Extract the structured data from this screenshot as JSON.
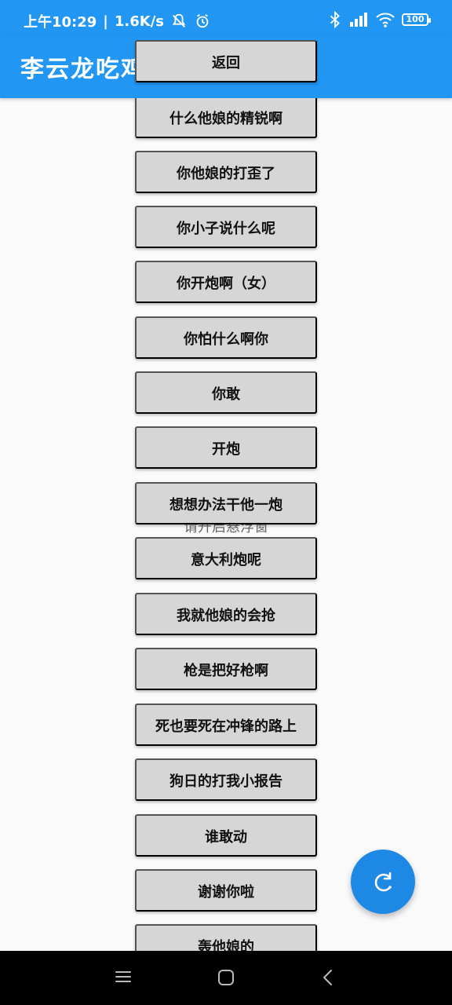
{
  "status_bar": {
    "time": "上午10:29",
    "speed": "1.6K/s",
    "battery": "100",
    "icons": [
      "bell-off-icon",
      "alarm-icon",
      "bluetooth-icon",
      "signal-icon",
      "wifi-icon",
      "battery-icon"
    ]
  },
  "app_bar": {
    "title": "李云龙吃鸡"
  },
  "hint": "请开启悬浮窗",
  "buttons": [
    "返回",
    "什么他娘的精锐啊",
    "你他娘的打歪了",
    "你小子说什么呢",
    "你开炮啊（女）",
    "你怕什么啊你",
    "你敢",
    "开炮",
    "想想办法干他一炮",
    "意大利炮呢",
    "我就他娘的会抢",
    "枪是把好枪啊",
    "死也要死在冲锋的路上",
    "狗日的打我小报告",
    "谁敢动",
    "谢谢你啦",
    "轰他娘的"
  ],
  "fab": {
    "icon": "refresh-icon"
  },
  "navigation": {
    "icons": [
      "menu-icon",
      "home-icon",
      "back-icon"
    ]
  },
  "colors": {
    "primary": "#2196f3",
    "fab": "#1e88e5",
    "button": "#d6d6d6",
    "background": "#fafafa"
  }
}
